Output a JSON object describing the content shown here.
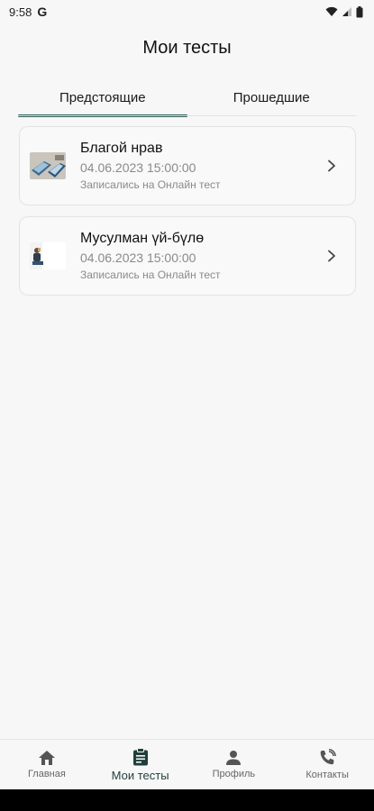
{
  "status_bar": {
    "time": "9:58",
    "g_logo": "G",
    "icons": [
      "wifi-icon",
      "signal-icon",
      "battery-icon"
    ]
  },
  "page": {
    "title": "Мои тесты"
  },
  "tabs": [
    {
      "label": "Предстоящие",
      "active": true
    },
    {
      "label": "Прошедшие",
      "active": false
    }
  ],
  "tests": [
    {
      "title": "Благой нрав",
      "datetime": "04.06.2023 15:00:00",
      "note": "Записались на Онлайн тест",
      "thumb": "books-image"
    },
    {
      "title": "Мусулман үй-бүлө",
      "datetime": "04.06.2023 15:00:00",
      "note": "Записались на Онлайн тест",
      "thumb": "family-image"
    }
  ],
  "bottom_nav": [
    {
      "label": "Главная",
      "icon": "home-icon",
      "active": false
    },
    {
      "label": "Мои тесты",
      "icon": "clipboard-icon",
      "active": true
    },
    {
      "label": "Профиль",
      "icon": "person-icon",
      "active": false
    },
    {
      "label": "Контакты",
      "icon": "phone-call-icon",
      "active": false
    }
  ],
  "colors": {
    "accent": "#2f5f5a",
    "background": "#f7f7f7",
    "muted_text": "#8a8a8a"
  }
}
